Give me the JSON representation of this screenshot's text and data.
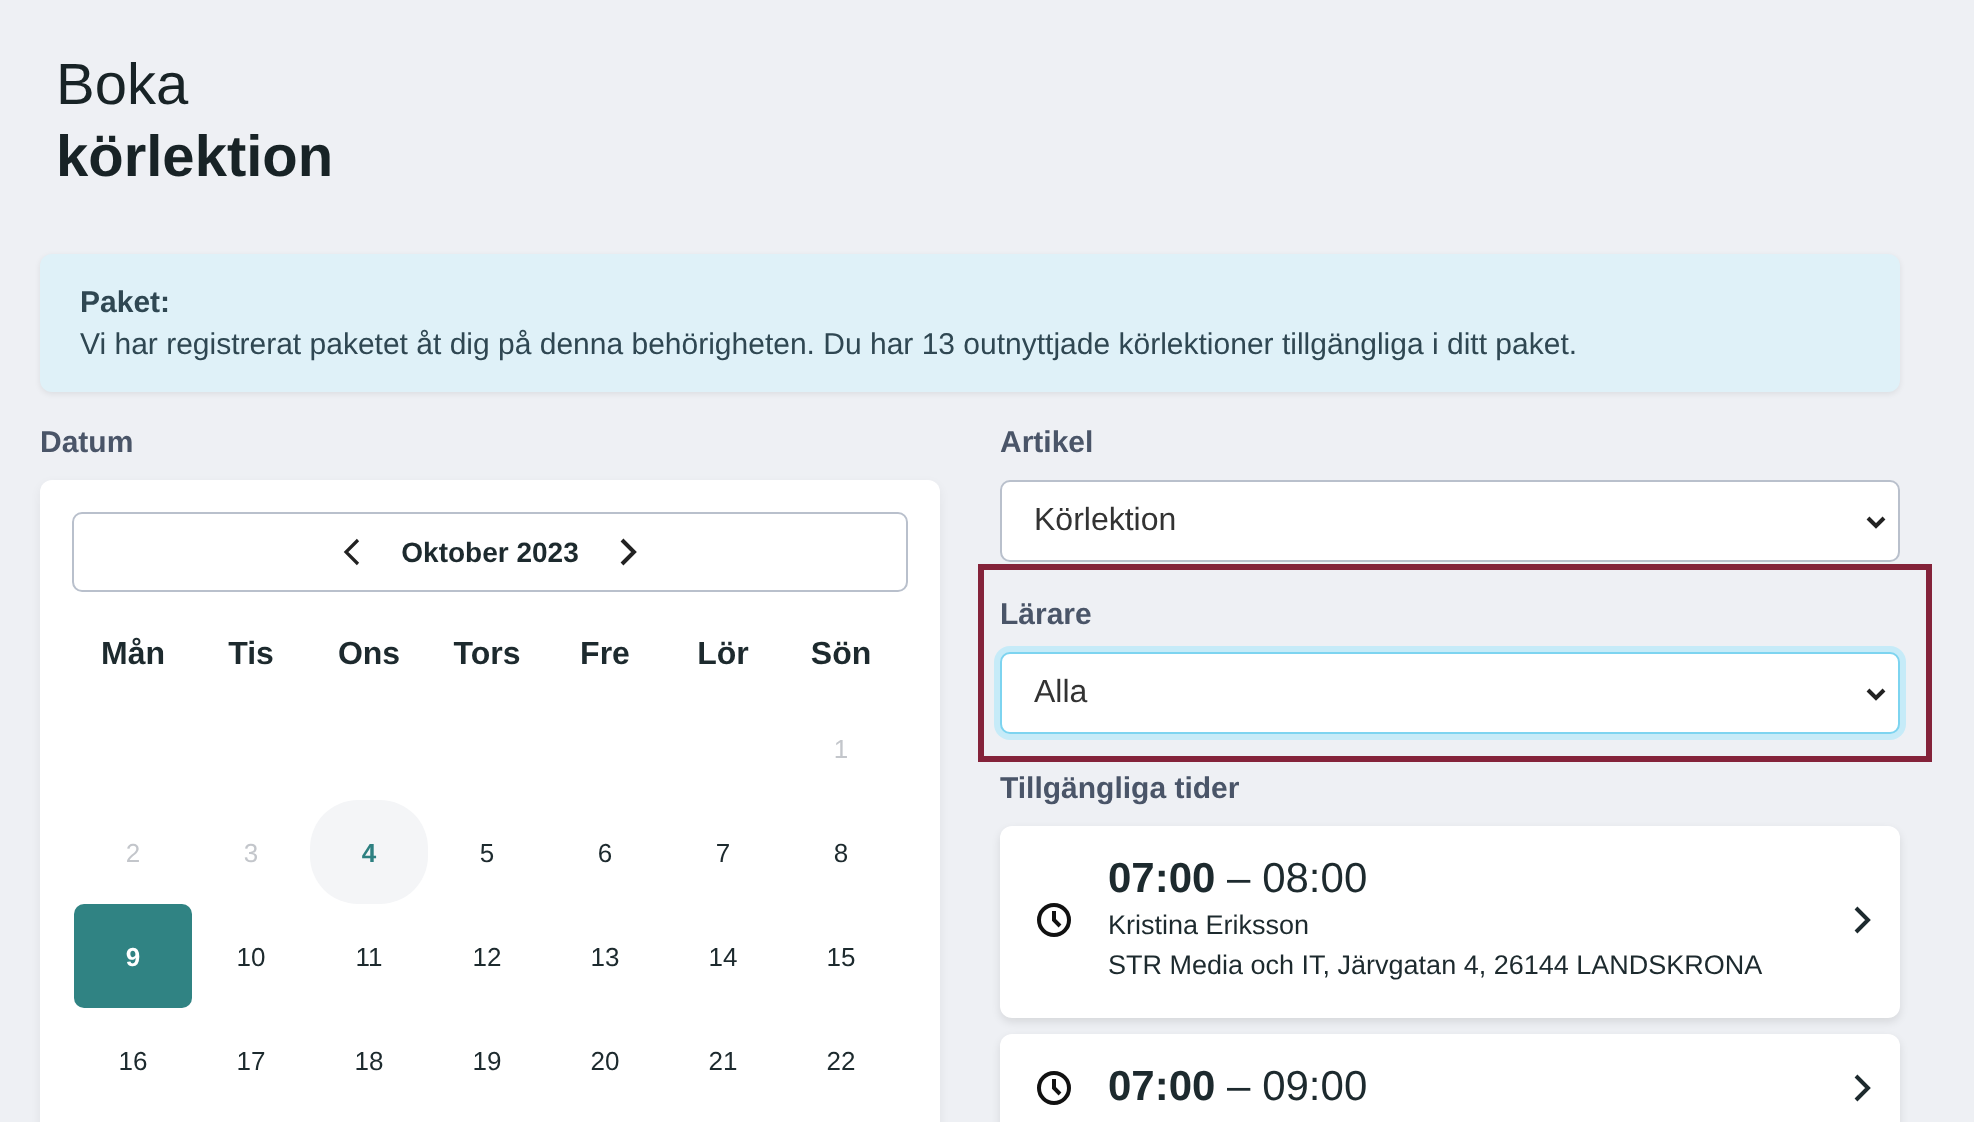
{
  "header": {
    "title_light": "Boka",
    "title_bold": "körlektion"
  },
  "info": {
    "heading": "Paket:",
    "text": "Vi har registrerat paketet åt dig på denna behörigheten. Du har 13 outnyttjade körlektioner tillgängliga i ditt paket."
  },
  "date": {
    "label": "Datum",
    "month": "Oktober 2023",
    "weekdays": [
      "Mån",
      "Tis",
      "Ons",
      "Tors",
      "Fre",
      "Lör",
      "Sön"
    ],
    "days": [
      {
        "kind": "blank"
      },
      {
        "kind": "blank"
      },
      {
        "kind": "blank"
      },
      {
        "kind": "blank"
      },
      {
        "kind": "blank"
      },
      {
        "kind": "blank"
      },
      {
        "kind": "day",
        "label": "1",
        "disabled": true,
        "today": false,
        "selected": false
      },
      {
        "kind": "day",
        "label": "2",
        "disabled": true,
        "today": false,
        "selected": false
      },
      {
        "kind": "day",
        "label": "3",
        "disabled": true,
        "today": false,
        "selected": false
      },
      {
        "kind": "day",
        "label": "4",
        "disabled": false,
        "today": true,
        "selected": false
      },
      {
        "kind": "day",
        "label": "5",
        "disabled": false,
        "today": false,
        "selected": false
      },
      {
        "kind": "day",
        "label": "6",
        "disabled": false,
        "today": false,
        "selected": false
      },
      {
        "kind": "day",
        "label": "7",
        "disabled": false,
        "today": false,
        "selected": false
      },
      {
        "kind": "day",
        "label": "8",
        "disabled": false,
        "today": false,
        "selected": false
      },
      {
        "kind": "day",
        "label": "9",
        "disabled": false,
        "today": false,
        "selected": true
      },
      {
        "kind": "day",
        "label": "10",
        "disabled": false,
        "today": false,
        "selected": false
      },
      {
        "kind": "day",
        "label": "11",
        "disabled": false,
        "today": false,
        "selected": false
      },
      {
        "kind": "day",
        "label": "12",
        "disabled": false,
        "today": false,
        "selected": false
      },
      {
        "kind": "day",
        "label": "13",
        "disabled": false,
        "today": false,
        "selected": false
      },
      {
        "kind": "day",
        "label": "14",
        "disabled": false,
        "today": false,
        "selected": false
      },
      {
        "kind": "day",
        "label": "15",
        "disabled": false,
        "today": false,
        "selected": false
      },
      {
        "kind": "day",
        "label": "16",
        "disabled": false,
        "today": false,
        "selected": false
      },
      {
        "kind": "day",
        "label": "17",
        "disabled": false,
        "today": false,
        "selected": false
      },
      {
        "kind": "day",
        "label": "18",
        "disabled": false,
        "today": false,
        "selected": false
      },
      {
        "kind": "day",
        "label": "19",
        "disabled": false,
        "today": false,
        "selected": false
      },
      {
        "kind": "day",
        "label": "20",
        "disabled": false,
        "today": false,
        "selected": false
      },
      {
        "kind": "day",
        "label": "21",
        "disabled": false,
        "today": false,
        "selected": false
      },
      {
        "kind": "day",
        "label": "22",
        "disabled": false,
        "today": false,
        "selected": false
      }
    ]
  },
  "article": {
    "label": "Artikel",
    "value": "Körlektion"
  },
  "teacher": {
    "label": "Lärare",
    "value": "Alla",
    "focused": true,
    "highlighted": true
  },
  "slots": {
    "label": "Tillgängliga tider",
    "items": [
      {
        "start": "07:00",
        "separator": "–",
        "end": "08:00",
        "teacher": "Kristina Eriksson",
        "location": "STR Media och IT, Järvgatan 4, 26144 LANDSKRONA"
      },
      {
        "start": "07:00",
        "separator": "–",
        "end": "09:00"
      }
    ]
  }
}
